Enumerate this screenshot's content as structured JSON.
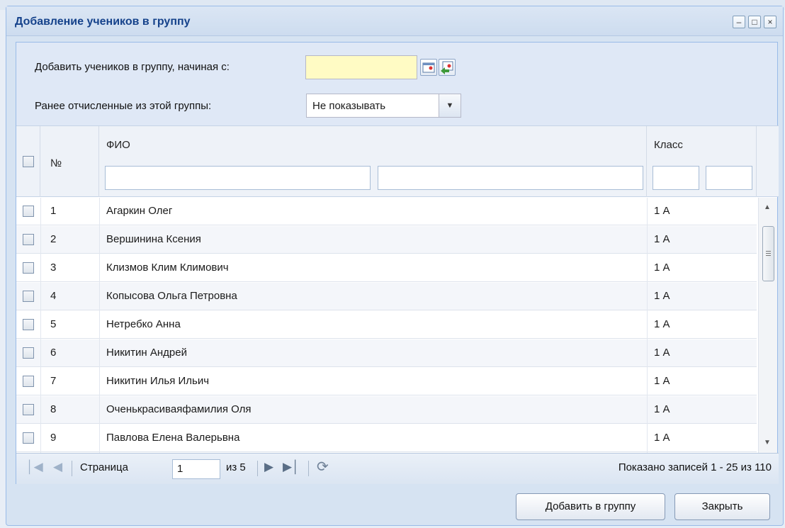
{
  "window": {
    "title": "Добавление учеников в группу",
    "minimize_icon": "minimize-icon",
    "maximize_icon": "maximize-icon",
    "close_icon": "close-icon"
  },
  "form": {
    "start_date_label": "Добавить учеников в группу, начиная с:",
    "start_date_value": "",
    "expelled_label": "Ранее отчисленные из этой группы:",
    "expelled_selected": "Не показывать"
  },
  "grid": {
    "columns": {
      "number": "№",
      "fio": "ФИО",
      "class": "Класс"
    },
    "rows": [
      {
        "num": "1",
        "fio": "Агаркин Олег",
        "class": "1 А"
      },
      {
        "num": "2",
        "fio": "Вершинина Ксения",
        "class": "1 А"
      },
      {
        "num": "3",
        "fio": "Клизмов Клим Климович",
        "class": "1 А"
      },
      {
        "num": "4",
        "fio": "Копысова Ольга Петровна",
        "class": "1 А"
      },
      {
        "num": "5",
        "fio": "Нетребко Анна",
        "class": "1 А"
      },
      {
        "num": "6",
        "fio": "Никитин Андрей",
        "class": "1 А"
      },
      {
        "num": "7",
        "fio": "Никитин Илья Ильич",
        "class": "1 А"
      },
      {
        "num": "8",
        "fio": "Оченькрасиваяфамилия Оля",
        "class": "1 А"
      },
      {
        "num": "9",
        "fio": "Павлова Елена Валерьвна",
        "class": "1 А"
      }
    ]
  },
  "paging": {
    "page_label": "Страница",
    "page_value": "1",
    "of_label": "из 5",
    "summary": "Показано записей 1 - 25 из 110"
  },
  "footer": {
    "add_button": "Добавить в группу",
    "close_button": "Закрыть"
  }
}
